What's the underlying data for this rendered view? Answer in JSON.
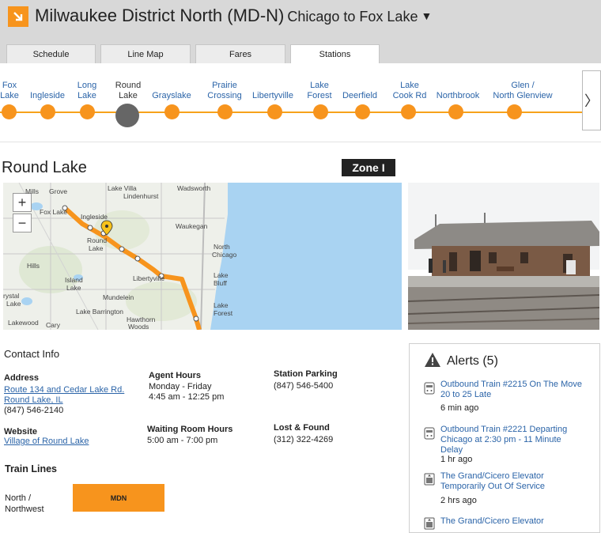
{
  "header": {
    "title": "Milwaukee District North (MD-N)",
    "subtitle": "Chicago to Fox Lake",
    "caret": "▼"
  },
  "tabs": [
    {
      "label": "Schedule",
      "active": false
    },
    {
      "label": "Line Map",
      "active": false
    },
    {
      "label": "Fares",
      "active": false
    },
    {
      "label": "Stations",
      "active": true
    }
  ],
  "stations": [
    {
      "line1": "Fox",
      "line2": "Lake",
      "current": false
    },
    {
      "line1": "",
      "line2": "Ingleside",
      "current": false
    },
    {
      "line1": "Long",
      "line2": "Lake",
      "current": false
    },
    {
      "line1": "Round",
      "line2": "Lake",
      "current": true
    },
    {
      "line1": "",
      "line2": "Grayslake",
      "current": false
    },
    {
      "line1": "Prairie",
      "line2": "Crossing",
      "current": false
    },
    {
      "line1": "",
      "line2": "Libertyville",
      "current": false
    },
    {
      "line1": "Lake",
      "line2": "Forest",
      "current": false
    },
    {
      "line1": "",
      "line2": "Deerfield",
      "current": false
    },
    {
      "line1": "Lake",
      "line2": "Cook Rd",
      "current": false
    },
    {
      "line1": "",
      "line2": "Northbrook",
      "current": false
    },
    {
      "line1": "Glen /",
      "line2": "North Glenview",
      "current": false
    }
  ],
  "next_arrow": "〉",
  "station": {
    "name": "Round Lake",
    "zone": "Zone I"
  },
  "map": {
    "zoom_in": "+",
    "zoom_out": "−",
    "labels": [
      "Mills",
      "Grove",
      "Lake Villa",
      "Lindenhurst",
      "Wadsworth",
      "Fox Lake",
      "Ingleside",
      "Round",
      "Lake",
      "Waukegan",
      "North",
      "Chicago",
      "Island",
      "Lake",
      "Libertyville",
      "Lake",
      "Bluff",
      "Mundelein",
      "rystal",
      "Lake",
      "Lake",
      "Forest",
      "Hawthorn",
      "Woods",
      "Lakewood",
      "Cary",
      "Hills",
      "Lake Barrington"
    ],
    "route_color": "#f7941d",
    "water_color": "#a9d3f2"
  },
  "contact": {
    "heading": "Contact Info",
    "address_label": "Address",
    "address_line1": "Route 134 and Cedar Lake Rd.",
    "address_line2": "Round Lake, IL",
    "address_phone": "(847) 546-2140",
    "agent_label": "Agent Hours",
    "agent_days": "Monday - Friday",
    "agent_time": "4:45 am - 12:25 pm",
    "parking_label": "Station Parking",
    "parking_phone": "(847) 546-5400",
    "website_label": "Website",
    "website_link": "Village of Round Lake",
    "waiting_label": "Waiting Room Hours",
    "waiting_time": "5:00 am - 7:00 pm",
    "lost_label": "Lost & Found",
    "lost_phone": "(312) 322-4269"
  },
  "train_lines": {
    "heading": "Train Lines",
    "line_name_1": "North /",
    "line_name_2": "Northwest",
    "badge": "MDN"
  },
  "alerts": {
    "title": "Alerts (5)",
    "items": [
      {
        "l1": "Outbound Train #2215 On The Move",
        "l2": "20 to 25 Late",
        "l3": "",
        "time": "6 min ago"
      },
      {
        "l1": "Outbound Train #2221 Departing",
        "l2": "Chicago at 2:30 pm - 11 Minute",
        "l3": "Delay",
        "time": "1 hr ago"
      },
      {
        "l1": "The Grand/Cicero Elevator",
        "l2": "Temporarily Out Of Service",
        "l3": "",
        "time": "2 hrs ago"
      },
      {
        "l1": "The Grand/Cicero Elevator",
        "l2": "",
        "l3": "",
        "time": ""
      }
    ]
  },
  "colors": {
    "accent": "#f7941d",
    "link": "#2b64a8",
    "header_bg": "#d8d8d8"
  }
}
